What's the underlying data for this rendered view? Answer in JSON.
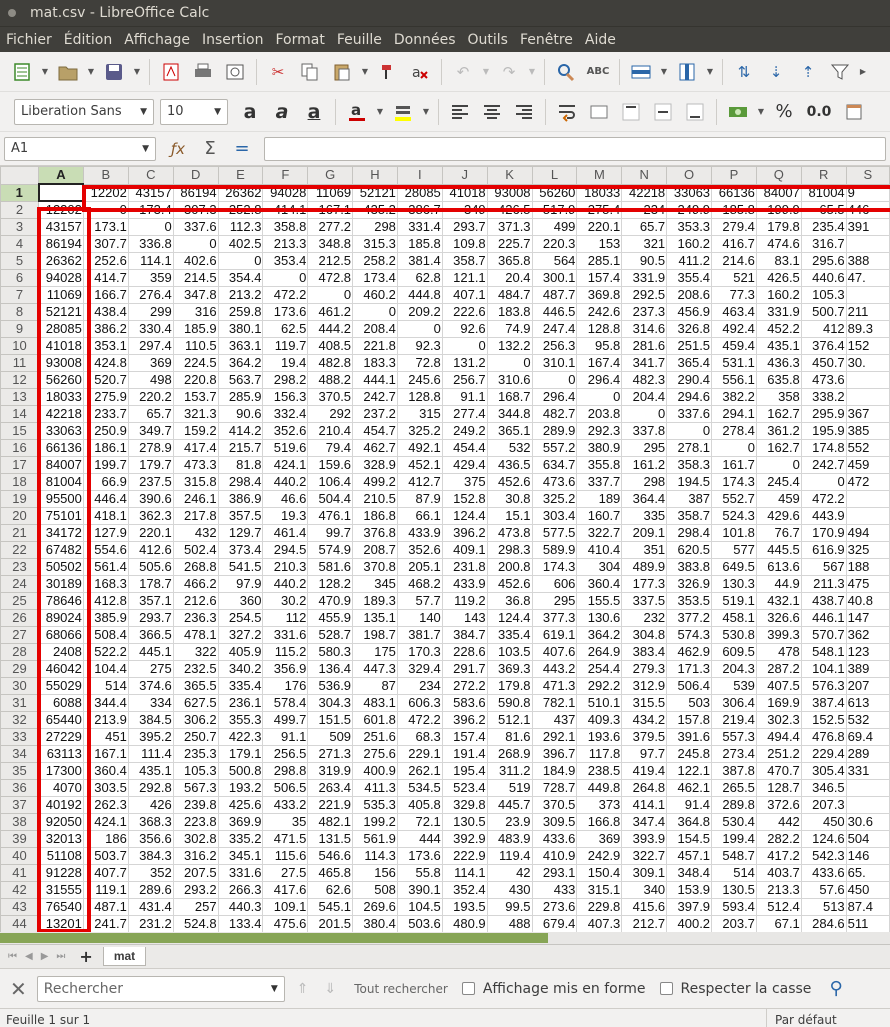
{
  "window": {
    "title": "mat.csv - LibreOffice Calc"
  },
  "menu": [
    "Fichier",
    "Édition",
    "Affichage",
    "Insertion",
    "Format",
    "Feuille",
    "Données",
    "Outils",
    "Fenêtre",
    "Aide"
  ],
  "format_toolbar": {
    "font_name": "Liberation Sans",
    "font_size": "10",
    "percent_label": "%",
    "decimal_label": "0.0"
  },
  "formula_bar": {
    "cell_ref": "A1",
    "formula": ""
  },
  "sheet": {
    "columns": [
      "A",
      "B",
      "C",
      "D",
      "E",
      "F",
      "G",
      "H",
      "I",
      "J",
      "K",
      "L",
      "M",
      "N",
      "O",
      "P",
      "Q",
      "R",
      "S"
    ],
    "rows": [
      [
        "",
        "12202",
        "43157",
        "86194",
        "26362",
        "94028",
        "11069",
        "52121",
        "28085",
        "41018",
        "93008",
        "56260",
        "18033",
        "42218",
        "33063",
        "66136",
        "84007",
        "81004",
        "9"
      ],
      [
        "12202",
        "0",
        "173.4",
        "307.3",
        "252.8",
        "414.1",
        "167.1",
        "435.2",
        "386.7",
        "349",
        "426.5",
        "517.9",
        "275.4",
        "234",
        "249.9",
        "185.8",
        "199.9",
        "65.5",
        "446"
      ],
      [
        "43157",
        "173.1",
        "0",
        "337.6",
        "112.3",
        "358.8",
        "277.2",
        "298",
        "331.4",
        "293.7",
        "371.3",
        "499",
        "220.1",
        "65.7",
        "353.3",
        "279.4",
        "179.8",
        "235.4",
        "391"
      ],
      [
        "86194",
        "307.7",
        "336.8",
        "0",
        "402.5",
        "213.3",
        "348.8",
        "315.3",
        "185.8",
        "109.8",
        "225.7",
        "220.3",
        "153",
        "321",
        "160.2",
        "416.7",
        "474.6",
        "316.7",
        ""
      ],
      [
        "26362",
        "252.6",
        "114.1",
        "402.6",
        "0",
        "353.4",
        "212.5",
        "258.2",
        "381.4",
        "358.7",
        "365.8",
        "564",
        "285.1",
        "90.5",
        "411.2",
        "214.6",
        "83.1",
        "295.6",
        "388"
      ],
      [
        "94028",
        "414.7",
        "359",
        "214.5",
        "354.4",
        "0",
        "472.8",
        "173.4",
        "62.8",
        "121.1",
        "20.4",
        "300.1",
        "157.4",
        "331.9",
        "355.4",
        "521",
        "426.5",
        "440.6",
        "47."
      ],
      [
        "11069",
        "166.7",
        "276.4",
        "347.8",
        "213.2",
        "472.2",
        "0",
        "460.2",
        "444.8",
        "407.1",
        "484.7",
        "487.7",
        "369.8",
        "292.5",
        "208.6",
        "77.3",
        "160.2",
        "105.3",
        ""
      ],
      [
        "52121",
        "438.4",
        "299",
        "316",
        "259.8",
        "173.6",
        "461.2",
        "0",
        "209.2",
        "222.6",
        "183.8",
        "446.5",
        "242.6",
        "237.3",
        "456.9",
        "463.4",
        "331.9",
        "500.7",
        "211"
      ],
      [
        "28085",
        "386.2",
        "330.4",
        "185.9",
        "380.1",
        "62.5",
        "444.2",
        "208.4",
        "0",
        "92.6",
        "74.9",
        "247.4",
        "128.8",
        "314.6",
        "326.8",
        "492.4",
        "452.2",
        "412",
        "89.3"
      ],
      [
        "41018",
        "353.1",
        "297.4",
        "110.5",
        "363.1",
        "119.7",
        "408.5",
        "221.8",
        "92.3",
        "0",
        "132.2",
        "256.3",
        "95.8",
        "281.6",
        "251.5",
        "459.4",
        "435.1",
        "376.4",
        "152"
      ],
      [
        "93008",
        "424.8",
        "369",
        "224.5",
        "364.2",
        "19.4",
        "482.8",
        "183.3",
        "72.8",
        "131.2",
        "0",
        "310.1",
        "167.4",
        "341.7",
        "365.4",
        "531.1",
        "436.3",
        "450.7",
        "30."
      ],
      [
        "56260",
        "520.7",
        "498",
        "220.8",
        "563.7",
        "298.2",
        "488.2",
        "444.1",
        "245.6",
        "256.7",
        "310.6",
        "0",
        "296.4",
        "482.3",
        "290.4",
        "556.1",
        "635.8",
        "473.6",
        ""
      ],
      [
        "18033",
        "275.9",
        "220.2",
        "153.7",
        "285.9",
        "156.3",
        "370.5",
        "242.7",
        "128.8",
        "91.1",
        "168.7",
        "296.4",
        "0",
        "204.4",
        "294.6",
        "382.2",
        "358",
        "338.2",
        ""
      ],
      [
        "42218",
        "233.7",
        "65.7",
        "321.3",
        "90.6",
        "332.4",
        "292",
        "237.2",
        "315",
        "277.4",
        "344.8",
        "482.7",
        "203.8",
        "0",
        "337.6",
        "294.1",
        "162.7",
        "295.9",
        "367"
      ],
      [
        "33063",
        "250.9",
        "349.7",
        "159.2",
        "414.2",
        "352.6",
        "210.4",
        "454.7",
        "325.2",
        "249.2",
        "365.1",
        "289.9",
        "292.3",
        "337.8",
        "0",
        "278.4",
        "361.2",
        "195.9",
        "385"
      ],
      [
        "66136",
        "186.1",
        "278.9",
        "417.4",
        "215.7",
        "519.6",
        "79.4",
        "462.7",
        "492.1",
        "454.4",
        "532",
        "557.2",
        "380.9",
        "295",
        "278.1",
        "0",
        "162.7",
        "174.8",
        "552"
      ],
      [
        "84007",
        "199.7",
        "179.7",
        "473.3",
        "81.8",
        "424.1",
        "159.6",
        "328.9",
        "452.1",
        "429.4",
        "436.5",
        "634.7",
        "355.8",
        "161.2",
        "358.3",
        "161.7",
        "0",
        "242.7",
        "459"
      ],
      [
        "81004",
        "66.9",
        "237.5",
        "315.8",
        "298.4",
        "440.2",
        "106.4",
        "499.2",
        "412.7",
        "375",
        "452.6",
        "473.6",
        "337.7",
        "298",
        "194.5",
        "174.3",
        "245.4",
        "0",
        "472"
      ],
      [
        "95500",
        "446.4",
        "390.6",
        "246.1",
        "386.9",
        "46.6",
        "504.4",
        "210.5",
        "87.9",
        "152.8",
        "30.8",
        "325.2",
        "189",
        "364.4",
        "387",
        "552.7",
        "459",
        "472.2",
        ""
      ],
      [
        "75101",
        "418.1",
        "362.3",
        "217.8",
        "357.5",
        "19.3",
        "476.1",
        "186.8",
        "66.1",
        "124.4",
        "15.1",
        "303.4",
        "160.7",
        "335",
        "358.7",
        "524.3",
        "429.6",
        "443.9",
        ""
      ],
      [
        "34172",
        "127.9",
        "220.1",
        "432",
        "129.7",
        "461.4",
        "99.7",
        "376.8",
        "433.9",
        "396.2",
        "473.8",
        "577.5",
        "322.7",
        "209.1",
        "298.4",
        "101.8",
        "76.7",
        "170.9",
        "494"
      ],
      [
        "67482",
        "554.6",
        "412.6",
        "502.4",
        "373.4",
        "294.5",
        "574.9",
        "208.7",
        "352.6",
        "409.1",
        "298.3",
        "589.9",
        "410.4",
        "351",
        "620.5",
        "577",
        "445.5",
        "616.9",
        "325"
      ],
      [
        "50502",
        "561.4",
        "505.6",
        "268.8",
        "541.5",
        "210.3",
        "581.6",
        "370.8",
        "205.1",
        "231.8",
        "200.8",
        "174.3",
        "304",
        "489.9",
        "383.8",
        "649.5",
        "613.6",
        "567",
        "188"
      ],
      [
        "30189",
        "168.3",
        "178.7",
        "466.2",
        "97.9",
        "440.2",
        "128.2",
        "345",
        "468.2",
        "433.9",
        "452.6",
        "606",
        "360.4",
        "177.3",
        "326.9",
        "130.3",
        "44.9",
        "211.3",
        "475"
      ],
      [
        "78646",
        "412.8",
        "357.1",
        "212.6",
        "360",
        "30.2",
        "470.9",
        "189.3",
        "57.7",
        "119.2",
        "36.8",
        "295",
        "155.5",
        "337.5",
        "353.5",
        "519.1",
        "432.1",
        "438.7",
        "40.8"
      ],
      [
        "89024",
        "385.9",
        "293.7",
        "236.3",
        "254.5",
        "112",
        "455.9",
        "135.1",
        "140",
        "143",
        "124.4",
        "377.3",
        "130.6",
        "232",
        "377.2",
        "458.1",
        "326.6",
        "446.1",
        "147"
      ],
      [
        "68066",
        "508.4",
        "366.5",
        "478.1",
        "327.2",
        "331.6",
        "528.7",
        "198.7",
        "381.7",
        "384.7",
        "335.4",
        "619.1",
        "364.2",
        "304.8",
        "574.3",
        "530.8",
        "399.3",
        "570.7",
        "362"
      ],
      [
        "2408",
        "522.2",
        "445.1",
        "322",
        "405.9",
        "115.2",
        "580.3",
        "175",
        "170.3",
        "228.6",
        "103.5",
        "407.6",
        "264.9",
        "383.4",
        "462.9",
        "609.5",
        "478",
        "548.1",
        "123"
      ],
      [
        "46042",
        "104.4",
        "275",
        "232.5",
        "340.2",
        "356.9",
        "136.4",
        "447.3",
        "329.4",
        "291.7",
        "369.3",
        "443.2",
        "254.4",
        "279.3",
        "171.3",
        "204.3",
        "287.2",
        "104.1",
        "389"
      ],
      [
        "55029",
        "514",
        "374.6",
        "365.5",
        "335.4",
        "176",
        "536.9",
        "87",
        "234",
        "272.2",
        "179.8",
        "471.3",
        "292.2",
        "312.9",
        "506.4",
        "539",
        "407.5",
        "576.3",
        "207"
      ],
      [
        "6088",
        "344.4",
        "334",
        "627.5",
        "236.1",
        "578.4",
        "304.3",
        "483.1",
        "606.3",
        "583.6",
        "590.8",
        "782.1",
        "510.1",
        "315.5",
        "503",
        "306.4",
        "169.9",
        "387.4",
        "613"
      ],
      [
        "65440",
        "213.9",
        "384.5",
        "306.2",
        "355.3",
        "499.7",
        "151.5",
        "601.8",
        "472.2",
        "396.2",
        "512.1",
        "437",
        "409.3",
        "434.2",
        "157.8",
        "219.4",
        "302.3",
        "152.5",
        "532"
      ],
      [
        "27229",
        "451",
        "395.2",
        "250.7",
        "422.3",
        "91.1",
        "509",
        "251.6",
        "68.3",
        "157.4",
        "81.6",
        "292.1",
        "193.6",
        "379.5",
        "391.6",
        "557.3",
        "494.4",
        "476.8",
        "69.4"
      ],
      [
        "63113",
        "167.1",
        "111.4",
        "235.3",
        "179.1",
        "256.5",
        "271.3",
        "275.6",
        "229.1",
        "191.4",
        "268.9",
        "396.7",
        "117.8",
        "97.7",
        "245.8",
        "273.4",
        "251.2",
        "229.4",
        "289"
      ],
      [
        "17300",
        "360.4",
        "435.1",
        "105.3",
        "500.8",
        "298.8",
        "319.9",
        "400.9",
        "262.1",
        "195.4",
        "311.2",
        "184.9",
        "238.5",
        "419.4",
        "122.1",
        "387.8",
        "470.7",
        "305.4",
        "331"
      ],
      [
        "4070",
        "303.5",
        "292.8",
        "567.3",
        "193.2",
        "506.5",
        "263.4",
        "411.3",
        "534.5",
        "523.4",
        "519",
        "728.7",
        "449.8",
        "264.8",
        "462.1",
        "265.5",
        "128.7",
        "346.5",
        ""
      ],
      [
        "40192",
        "262.3",
        "426",
        "239.8",
        "425.6",
        "433.2",
        "221.9",
        "535.3",
        "405.8",
        "329.8",
        "445.7",
        "370.5",
        "373",
        "414.1",
        "91.4",
        "289.8",
        "372.6",
        "207.3",
        ""
      ],
      [
        "92050",
        "424.1",
        "368.3",
        "223.8",
        "369.9",
        "35",
        "482.1",
        "199.2",
        "72.1",
        "130.5",
        "23.9",
        "309.5",
        "166.8",
        "347.4",
        "364.8",
        "530.4",
        "442",
        "450",
        "30.6"
      ],
      [
        "32013",
        "186",
        "356.6",
        "302.8",
        "335.2",
        "471.5",
        "131.5",
        "561.9",
        "444",
        "392.9",
        "483.9",
        "433.6",
        "369",
        "393.9",
        "154.5",
        "199.4",
        "282.2",
        "124.6",
        "504"
      ],
      [
        "51108",
        "503.7",
        "384.3",
        "316.2",
        "345.1",
        "115.6",
        "546.6",
        "114.3",
        "173.6",
        "222.9",
        "119.4",
        "410.9",
        "242.9",
        "322.7",
        "457.1",
        "548.7",
        "417.2",
        "542.3",
        "146"
      ],
      [
        "91228",
        "407.7",
        "352",
        "207.5",
        "331.6",
        "27.5",
        "465.8",
        "156",
        "55.8",
        "114.1",
        "42",
        "293.1",
        "150.4",
        "309.1",
        "348.4",
        "514",
        "403.7",
        "433.6",
        "65."
      ],
      [
        "31555",
        "119.1",
        "289.6",
        "293.2",
        "266.3",
        "417.6",
        "62.6",
        "508",
        "390.1",
        "352.4",
        "430",
        "433",
        "315.1",
        "340",
        "153.9",
        "130.5",
        "213.3",
        "57.6",
        "450"
      ],
      [
        "76540",
        "487.1",
        "431.4",
        "257",
        "440.3",
        "109.1",
        "545.1",
        "269.6",
        "104.5",
        "193.5",
        "99.5",
        "273.6",
        "229.8",
        "415.6",
        "397.9",
        "593.4",
        "512.4",
        "513",
        "87.4"
      ],
      [
        "13201",
        "241.7",
        "231.2",
        "524.8",
        "133.4",
        "475.6",
        "201.5",
        "380.4",
        "503.6",
        "480.9",
        "488",
        "679.4",
        "407.3",
        "212.7",
        "400.2",
        "203.7",
        "67.1",
        "284.6",
        "511"
      ]
    ]
  },
  "tabs": {
    "sheet_name": "mat",
    "add": "+"
  },
  "findbar": {
    "placeholder": "Rechercher",
    "find_all": "Tout rechercher",
    "formatted": "Affichage mis en forme",
    "match_case": "Respecter la casse"
  },
  "status": {
    "sheet_info": "Feuille 1 sur 1",
    "style": "Par défaut"
  }
}
